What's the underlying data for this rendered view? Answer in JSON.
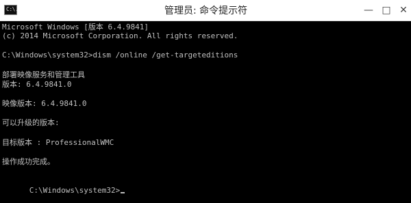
{
  "window": {
    "title": "管理员: 命令提示符",
    "icon": "command-prompt-icon",
    "icon_text": "C:\\.",
    "controls": {
      "minimize": "—",
      "maximize": "□",
      "close": "✕"
    }
  },
  "console": {
    "lines": [
      "Microsoft Windows [版本 6.4.9841]",
      "(c) 2014 Microsoft Corporation. All rights reserved.",
      "",
      "C:\\Windows\\system32>dism /online /get-targeteditions",
      "",
      "部署映像服务和管理工具",
      "版本: 6.4.9841.0",
      "",
      "映像版本: 6.4.9841.0",
      "",
      "可以升级的版本:",
      "",
      "目标版本 : ProfessionalWMC",
      "",
      "操作成功完成。",
      "",
      "C:\\Windows\\system32>"
    ]
  },
  "colors": {
    "console_background": "#000000",
    "console_text": "#c0c0c0",
    "titlebar_background": "#ffffff"
  }
}
